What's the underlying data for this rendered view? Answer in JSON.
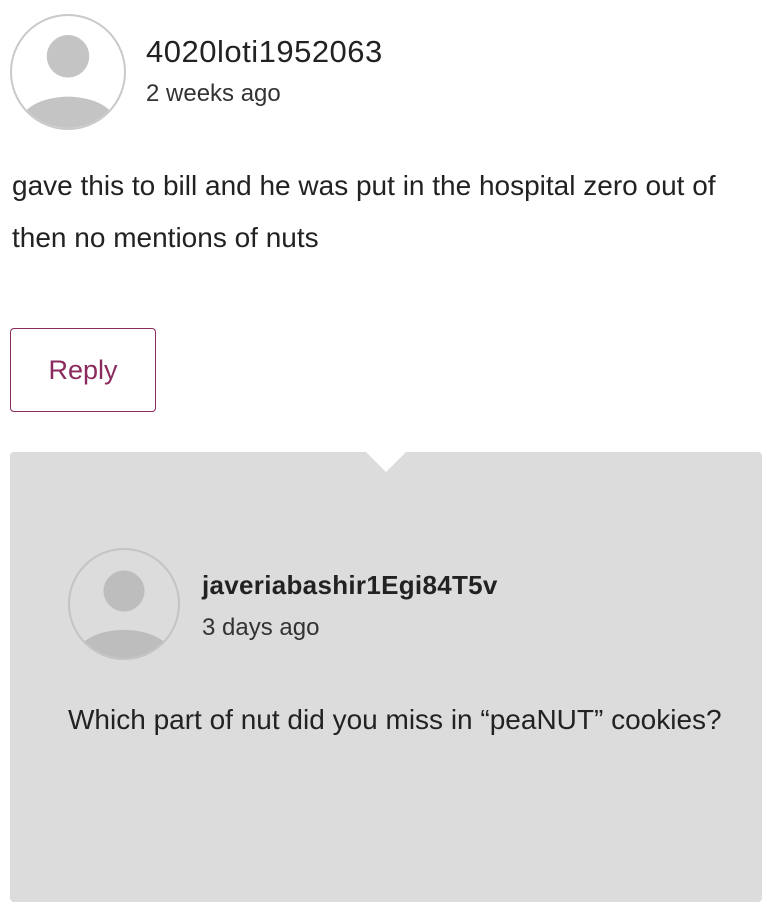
{
  "comment": {
    "username": "4020loti1952063",
    "timestamp": "2 weeks ago",
    "text": "gave this to bill and he was put in the hospital zero out of then no mentions of nuts",
    "avatar_icon": "user-silhouette-icon"
  },
  "reply_button": {
    "label": "Reply",
    "color": "#8b2a5e"
  },
  "reply": {
    "username": "javeriabashir1Egi84T5v",
    "timestamp": "3 days ago",
    "text": "Which part of nut did you miss in “peaNUT” cookies?",
    "avatar_icon": "user-silhouette-icon",
    "background": "#dcdcdc"
  }
}
